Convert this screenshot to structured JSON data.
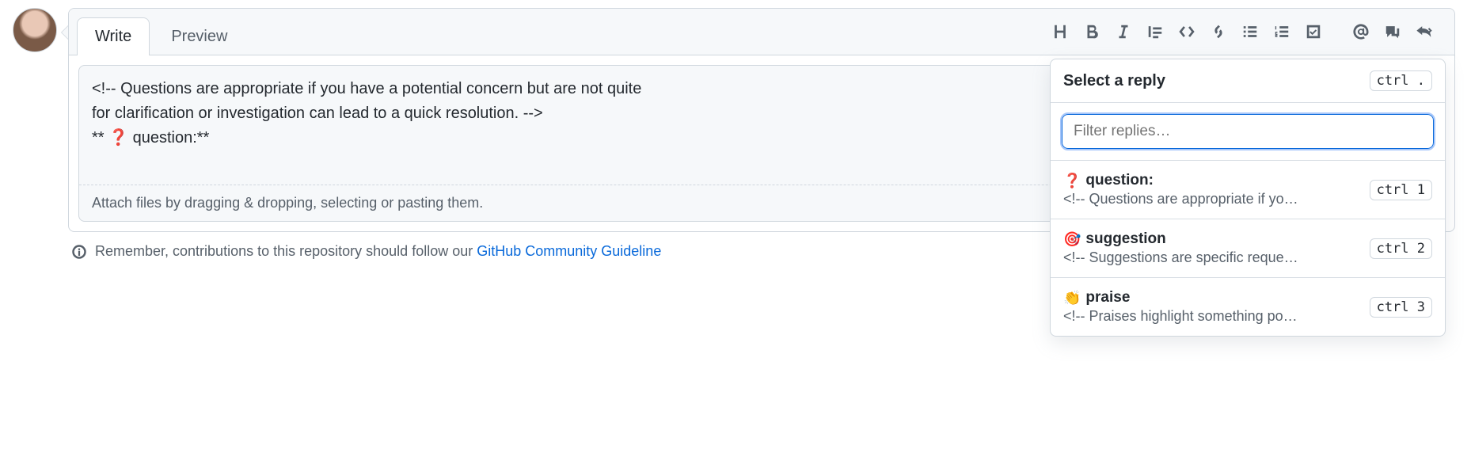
{
  "tabs": {
    "write": "Write",
    "preview": "Preview"
  },
  "textarea": {
    "line1": "<!-- Questions are appropriate if you have a potential concern but are not quite",
    "line2": "for clarification or investigation can lead to a quick resolution. -->",
    "line3_prefix": "** ",
    "line3_icon": "❓",
    "line3_suffix": " question:**"
  },
  "attach_hint": "Attach files by dragging & dropping, selecting or pasting them.",
  "footer": {
    "prefix": "Remember, contributions to this repository should follow our ",
    "link": "GitHub Community Guideline"
  },
  "popover": {
    "title": "Select a reply",
    "header_kbd": "ctrl .",
    "filter_placeholder": "Filter replies…",
    "items": [
      {
        "emoji": "❓",
        "title": "question:",
        "sub": "<!-- Questions are appropriate if yo…",
        "kbd": "ctrl 1",
        "red": true
      },
      {
        "emoji": "🎯",
        "title": "suggestion",
        "sub": "<!-- Suggestions are specific reque…",
        "kbd": "ctrl 2",
        "red": false
      },
      {
        "emoji": "👏",
        "title": "praise",
        "sub": "<!-- Praises highlight something po…",
        "kbd": "ctrl 3",
        "red": false
      }
    ]
  }
}
